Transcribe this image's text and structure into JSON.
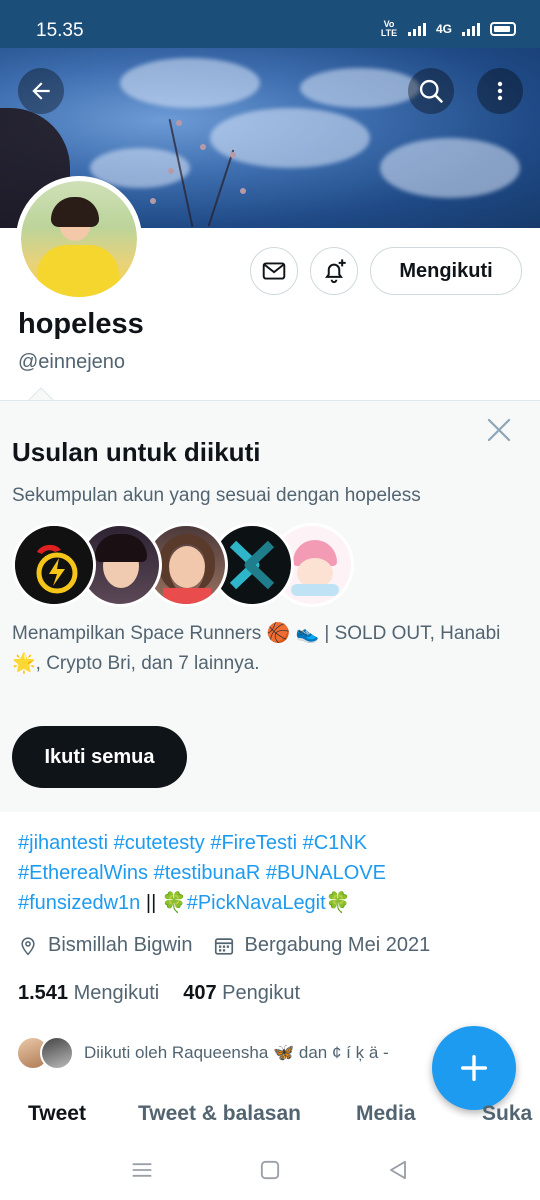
{
  "status_bar": {
    "time": "15.35",
    "network": "4G",
    "volte": "Vo LTE"
  },
  "profile": {
    "name": "hopeless",
    "handle": "@einnejeno",
    "following_button": "Mengikuti"
  },
  "suggestions": {
    "title": "Usulan untuk diikuti",
    "subtitle": "Sekumpulan akun yang sesuai dengan hopeless",
    "description": "Menampilkan Space Runners 🏀 👟 | SOLD OUT, Hanabi🌟, Crypto Bri, dan 7 lainnya.",
    "follow_all": "Ikuti semua"
  },
  "bio": {
    "line1": "#jihantesti #cutetesty #FireTesti #C1NK",
    "line2": "#EtherealWins #testibunaR #BUNALOVE",
    "line3_tag1": "#funsizedw1n",
    "line3_sep": " || 🍀",
    "line3_tag2": "#PickNavaLegit",
    "line3_end": "🍀"
  },
  "meta": {
    "location": "Bismillah Bigwin",
    "joined": "Bergabung Mei 2021"
  },
  "stats": {
    "following_count": "1.541",
    "following_label": "Mengikuti",
    "followers_count": "407",
    "followers_label": "Pengikut"
  },
  "followed_by": "Diikuti oleh Raqueensha 🦋 dan ¢ í ķ ä -",
  "tabs": [
    "Tweet",
    "Tweet & balasan",
    "Media",
    "Suka"
  ],
  "colors": {
    "accent": "#1d9bf0",
    "text": "#0f1419",
    "secondary": "#536471",
    "banner": "#1f4a86"
  }
}
